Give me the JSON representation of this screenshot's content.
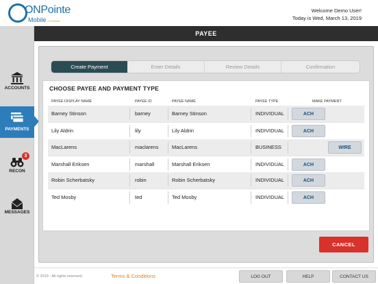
{
  "header": {
    "brand_on": "ON",
    "brand_pointe": "Pointe",
    "brand_sub": "Mobile",
    "brand_tag": "CUMobile",
    "welcome": "Welcome Demo User!",
    "date": "Today is Wed, March 13, 2019"
  },
  "title": "PAYEE",
  "sidebar": {
    "items": [
      {
        "label": "ACCOUNTS",
        "icon": "bank-icon"
      },
      {
        "label": "PAYMENTS",
        "icon": "payments-icon",
        "active": true
      },
      {
        "label": "RECON",
        "icon": "binoculars-icon",
        "badge": "3"
      },
      {
        "label": "MESSAGES",
        "icon": "envelope-icon"
      }
    ]
  },
  "steps": [
    "Create Payment",
    "Enter Details",
    "Review Details",
    "Confirmation"
  ],
  "card_title": "CHOOSE PAYEE AND PAYMENT TYPE",
  "columns": [
    "PAYEE DISPLAY NAME",
    "PAYEE ID",
    "PAYEE NAME",
    "PAYEE TYPE",
    "MAKE PAYMENT"
  ],
  "rows": [
    {
      "display": "Barney Stinson",
      "id": "barney",
      "name": "Barney Stinson",
      "type": "INDIVIDUAL",
      "button": "ACH"
    },
    {
      "display": "Lily Aldrin",
      "id": "lily",
      "name": "Lily Aldrin",
      "type": "INDIVIDUAL",
      "button": "ACH"
    },
    {
      "display": "MacLarens",
      "id": "maclarens",
      "name": "MacLarens",
      "type": "BUSINESS",
      "button": "WIRE"
    },
    {
      "display": "Marshall Eriksen",
      "id": "marshall",
      "name": "Marshall Eriksen",
      "type": "INDIVIDUAL",
      "button": "ACH"
    },
    {
      "display": "Robin Scherbatsky",
      "id": "robin",
      "name": "Robin Scherbatsky",
      "type": "INDIVIDUAL",
      "button": "ACH"
    },
    {
      "display": "Ted Mosby",
      "id": "ted",
      "name": "Ted Mosby",
      "type": "INDIVIDUAL",
      "button": "ACH"
    }
  ],
  "cancel_label": "CANCEL",
  "footer": {
    "copyright": "© 2019 - All rights reserved.",
    "terms": "Terms & Conditions",
    "logout": "LOG OUT",
    "help": "HELP",
    "contact": "CONTACT US"
  },
  "colors": {
    "accent": "#2e7dbb",
    "cancel": "#d9312b",
    "link": "#e07e1b",
    "step_active": "#2c4c55"
  }
}
